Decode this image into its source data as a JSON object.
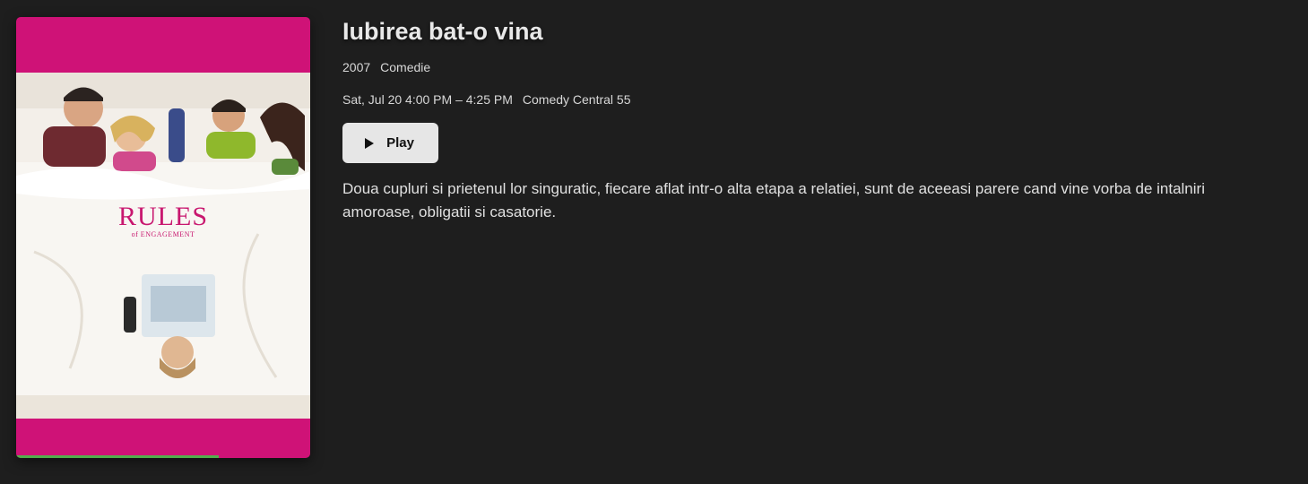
{
  "program": {
    "title": "Iubirea bat-o vina",
    "year": "2007",
    "genre": "Comedie",
    "schedule": "Sat, Jul 20 4:00 PM – 4:25 PM",
    "channel": "Comedy Central 55",
    "overview": "Doua cupluri si prietenul lor singuratic, fiecare aflat intr-o alta etapa a relatiei, sunt de aceeasi parere cand vine vorba de intalniri amoroase, obligatii si casatorie.",
    "progress_fraction": 0.69
  },
  "poster": {
    "logo_title": "RULES",
    "logo_subtitle": "of ENGAGEMENT",
    "background_color": "#cf1277"
  },
  "actions": {
    "play_label": "Play",
    "play_icon": "play-icon"
  },
  "colors": {
    "background": "#1e1e1e",
    "progress": "#52b04c",
    "button": "#e6e6e6"
  }
}
